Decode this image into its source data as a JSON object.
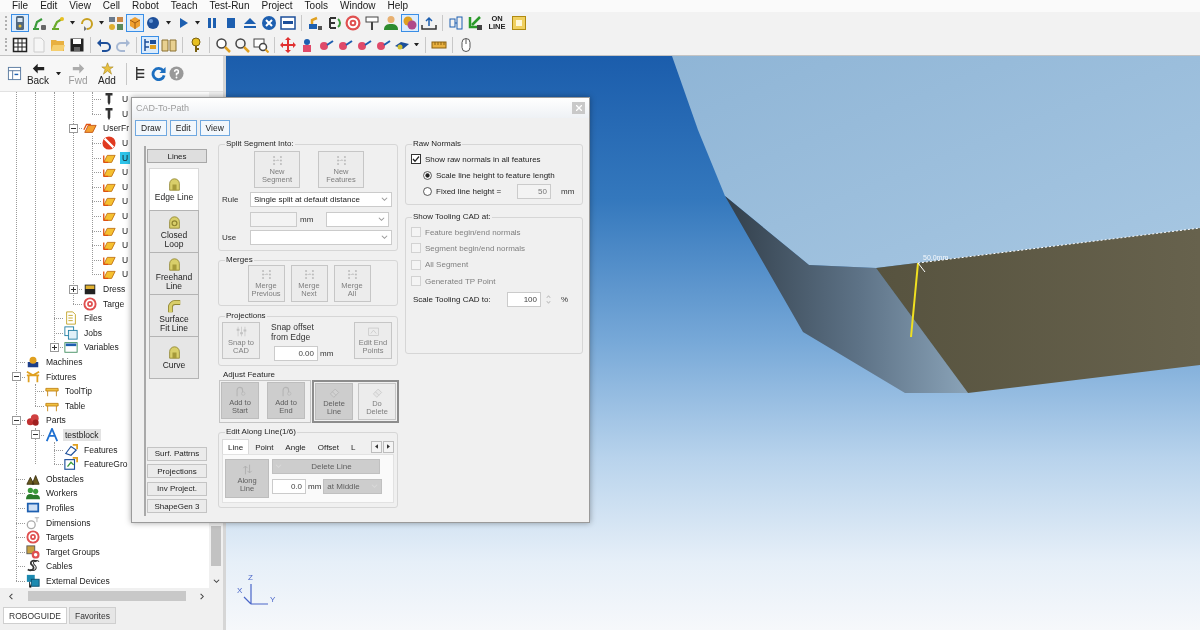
{
  "menu": [
    "File",
    "Edit",
    "View",
    "Cell",
    "Robot",
    "Teach",
    "Test-Run",
    "Project",
    "Tools",
    "Window",
    "Help"
  ],
  "toolbar_1": [
    {
      "kind": "pendant",
      "pressed": true
    },
    {
      "kind": "robot-lock",
      "pressed": false
    },
    {
      "kind": "robot-arm",
      "pressed": false
    },
    {
      "kind": "caret"
    },
    {
      "kind": "loop",
      "pressed": false
    },
    {
      "kind": "caret"
    },
    {
      "kind": "components",
      "pressed": false
    },
    {
      "kind": "cube",
      "pressed": true
    },
    {
      "kind": "sphere",
      "pressed": false
    },
    {
      "kind": "caret"
    },
    {
      "kind": "play",
      "pressed": false
    },
    {
      "kind": "caret"
    },
    {
      "kind": "pause",
      "pressed": false
    },
    {
      "kind": "stop",
      "pressed": false
    },
    {
      "kind": "eject",
      "pressed": false
    },
    {
      "kind": "cancel",
      "pressed": false
    },
    {
      "kind": "display",
      "pressed": false
    },
    {
      "kind": "separator"
    },
    {
      "kind": "robot-home",
      "pressed": false
    },
    {
      "kind": "rotate",
      "pressed": false
    },
    {
      "kind": "target",
      "pressed": false
    },
    {
      "kind": "signpost",
      "pressed": false
    },
    {
      "kind": "person",
      "pressed": false
    },
    {
      "kind": "collision",
      "pressed": true
    },
    {
      "kind": "upload",
      "pressed": false
    },
    {
      "kind": "separator"
    },
    {
      "kind": "connector",
      "pressed": false
    },
    {
      "kind": "arrow-corner",
      "pressed": false
    },
    {
      "kind": "online",
      "label": "ON LINE",
      "pressed": false
    },
    {
      "kind": "frame-tool",
      "pressed": false
    }
  ],
  "toolbar_2": [
    {
      "kind": "grid",
      "pressed": false,
      "disabled": false
    },
    {
      "kind": "new",
      "pressed": false,
      "disabled": true
    },
    {
      "kind": "open",
      "pressed": false,
      "disabled": false
    },
    {
      "kind": "save",
      "pressed": false,
      "disabled": false
    },
    {
      "kind": "separator"
    },
    {
      "kind": "undo",
      "pressed": false,
      "disabled": false
    },
    {
      "kind": "redo",
      "pressed": false,
      "disabled": true
    },
    {
      "kind": "separator"
    },
    {
      "kind": "tree-view",
      "pressed": true,
      "disabled": false
    },
    {
      "kind": "book",
      "pressed": false,
      "disabled": false
    },
    {
      "kind": "separator"
    },
    {
      "kind": "key",
      "pressed": false,
      "disabled": false
    },
    {
      "kind": "separator"
    },
    {
      "kind": "zoom-in",
      "pressed": false,
      "disabled": false
    },
    {
      "kind": "zoom-out",
      "pressed": false,
      "disabled": false
    },
    {
      "kind": "zoom-window",
      "pressed": false,
      "disabled": false
    },
    {
      "kind": "separator"
    },
    {
      "kind": "move",
      "pressed": false,
      "disabled": false
    },
    {
      "kind": "jog",
      "pressed": false,
      "disabled": false
    },
    {
      "kind": "joint",
      "pressed": false,
      "disabled": false
    },
    {
      "kind": "joint",
      "pressed": false,
      "disabled": false
    },
    {
      "kind": "joint",
      "pressed": false,
      "disabled": false
    },
    {
      "kind": "joint",
      "pressed": false,
      "disabled": false
    },
    {
      "kind": "tool",
      "pressed": false,
      "disabled": false
    },
    {
      "kind": "caret"
    },
    {
      "kind": "separator"
    },
    {
      "kind": "ruler",
      "pressed": false,
      "disabled": false
    },
    {
      "kind": "separator"
    },
    {
      "kind": "mouse",
      "pressed": false,
      "disabled": false
    }
  ],
  "browser_toolbar": [
    {
      "kind": "panel",
      "disabled": false
    },
    {
      "kind": "back",
      "label": "Back",
      "disabled": false
    },
    {
      "kind": "caret"
    },
    {
      "kind": "forward",
      "label": "Fwd",
      "disabled": true
    },
    {
      "kind": "add",
      "label": "Add",
      "disabled": false
    },
    {
      "kind": "separator"
    },
    {
      "kind": "hierarchy",
      "disabled": false
    },
    {
      "kind": "refresh",
      "disabled": false
    },
    {
      "kind": "help",
      "disabled": false
    }
  ],
  "tree": {
    "items": [
      {
        "children": [
          {
            "children": [
              {
                "children": [
                  {
                    "children": [
                      {
                        "kind": "tool-pin",
                        "label": "U",
                        "selected": false
                      },
                      {
                        "kind": "tool-pin",
                        "label": "U",
                        "selected": false
                      }
                    ]
                  },
                  {
                    "kind": "frames",
                    "label": "UserFr",
                    "expanded": true,
                    "selected": false,
                    "children": [
                      {
                        "kind": "frame-error",
                        "label": "U",
                        "selected": false
                      },
                      {
                        "kind": "user-frame",
                        "label": "U",
                        "selected": true
                      },
                      {
                        "kind": "user-frame",
                        "label": "U",
                        "selected": false
                      },
                      {
                        "kind": "user-frame",
                        "label": "U",
                        "selected": false
                      },
                      {
                        "kind": "user-frame",
                        "label": "U",
                        "selected": false
                      },
                      {
                        "kind": "user-frame",
                        "label": "U",
                        "selected": false
                      },
                      {
                        "kind": "user-frame",
                        "label": "U",
                        "selected": false
                      },
                      {
                        "kind": "user-frame",
                        "label": "U",
                        "selected": false
                      },
                      {
                        "kind": "user-frame",
                        "label": "U",
                        "selected": false
                      },
                      {
                        "kind": "user-frame",
                        "label": "U",
                        "selected": false
                      }
                    ]
                  },
                  {
                    "kind": "dresser",
                    "label": "Dress",
                    "expanded": false,
                    "selected": false
                  },
                  {
                    "kind": "target",
                    "label": "Targe",
                    "selected": false
                  }
                ]
              },
              {
                "kind": "files",
                "label": "Files",
                "selected": false
              },
              {
                "kind": "jobs",
                "label": "Jobs",
                "selected": false
              },
              {
                "kind": "variables",
                "label": "Variables",
                "expanded": false,
                "selected": false
              }
            ]
          }
        ]
      },
      {
        "kind": "machines",
        "label": "Machines",
        "selected": false
      },
      {
        "kind": "fixtures",
        "label": "Fixtures",
        "expanded": true,
        "selected": false,
        "children": [
          {
            "kind": "fixture",
            "label": "ToolTip",
            "selected": false
          },
          {
            "kind": "fixture",
            "label": "Table",
            "selected": false
          }
        ]
      },
      {
        "kind": "parts",
        "label": "Parts",
        "expanded": true,
        "selected": false,
        "children": [
          {
            "kind": "part",
            "label": "testblock",
            "expanded": true,
            "selected": false,
            "current": true,
            "children": [
              {
                "kind": "features",
                "label": "Features",
                "selected": false
              },
              {
                "kind": "feature-groups",
                "label": "FeatureGro",
                "selected": false
              }
            ]
          }
        ]
      },
      {
        "kind": "obstacles",
        "label": "Obstacles",
        "selected": false
      },
      {
        "kind": "workers",
        "label": "Workers",
        "selected": false
      },
      {
        "kind": "profiles",
        "label": "Profiles",
        "selected": false
      },
      {
        "kind": "dimensions",
        "label": "Dimensions",
        "selected": false
      },
      {
        "kind": "targets",
        "label": "Targets",
        "selected": false
      },
      {
        "kind": "target-groups",
        "label": "Target Groups",
        "selected": false
      },
      {
        "kind": "cables",
        "label": "Cables",
        "selected": false
      },
      {
        "kind": "external-devices",
        "label": "External Devices",
        "selected": false
      }
    ]
  },
  "browser_tabs": [
    {
      "label": "ROBOGUIDE",
      "selected": true
    },
    {
      "label": "Favorites",
      "selected": false
    }
  ],
  "viewport": {
    "measurement": "50.0mm",
    "axes": [
      "Z",
      "X",
      "Y"
    ]
  },
  "dialog": {
    "title": "CAD-To-Path",
    "menu": [
      "Draw",
      "Edit",
      "View"
    ],
    "side_tabs": [
      {
        "label": "Lines",
        "selected": true
      },
      {
        "label": "Surf. Pattrns",
        "selected": false
      },
      {
        "label": "Projections",
        "selected": false
      },
      {
        "label": "Inv Project.",
        "selected": false
      },
      {
        "label": "ShapeGen 3",
        "selected": false
      }
    ],
    "tools": [
      {
        "kind": "arch",
        "label": "Edge Line",
        "selected": true
      },
      {
        "kind": "ring",
        "label": "Closed\nLoop",
        "selected": false
      },
      {
        "kind": "arch",
        "label": "Freehand\nLine",
        "selected": false
      },
      {
        "kind": "pipe",
        "label": "Surface\nFit Line",
        "selected": false
      },
      {
        "kind": "arch",
        "label": "Curve",
        "selected": false
      }
    ],
    "split": {
      "title": "Split Segment Into:",
      "buttons": [
        {
          "label": "New\nSegment",
          "disabled": true
        },
        {
          "label": "New\nFeatures",
          "disabled": true
        }
      ],
      "rule_label": "Rule",
      "rule": {
        "value": "Single split at default distance",
        "disabled": false
      },
      "distance": {
        "disabled": true
      },
      "distance_unit": "mm",
      "distance_mode": {
        "disabled": false
      },
      "use_label": "Use",
      "use": {
        "disabled": false
      }
    },
    "merges": {
      "title": "Merges",
      "buttons": [
        {
          "label": "Merge\nPrevious",
          "disabled": true
        },
        {
          "label": "Merge\nNext",
          "disabled": true
        },
        {
          "label": "Merge\nAll",
          "disabled": true
        }
      ]
    },
    "projections": {
      "title": "Projections",
      "snap": {
        "label": "Snap to\nCAD",
        "disabled": true
      },
      "offset_label": "Snap offset\nfrom Edge",
      "offset": {
        "value": "0.00",
        "disabled": false
      },
      "offset_unit": "mm",
      "end_points": {
        "label": "Edit End\nPoints",
        "disabled": true
      }
    },
    "adjust": {
      "title": "Adjust Feature",
      "button_groups": [
        {
          "buttons": [
            {
              "kind": "toggle",
              "label": "Add to\nStart",
              "disabled": true
            },
            {
              "kind": "toggle",
              "label": "Add to\nEnd",
              "disabled": true
            }
          ]
        },
        {
          "buttons": [
            {
              "kind": "toggle",
              "label": "Delete\nLine",
              "disabled": true
            },
            {
              "kind": "push",
              "label": "Do\nDelete",
              "disabled": true
            }
          ]
        }
      ]
    },
    "edit_along": {
      "title": "Edit Along Line(1/6)",
      "tabs": [
        {
          "label": "Line",
          "selected": true
        },
        {
          "label": "Point",
          "selected": false
        },
        {
          "label": "Angle",
          "selected": false
        },
        {
          "label": "Offset",
          "selected": false
        },
        {
          "label": "L",
          "selected": false
        }
      ],
      "along": {
        "kind": "toggle",
        "label": "Along\nLine",
        "disabled": true
      },
      "action": {
        "value": "Delete Line",
        "disabled": true
      },
      "distance": {
        "value": "0.0",
        "disabled": false
      },
      "distance_unit": "mm",
      "anchor": {
        "value": "at Middle",
        "disabled": true
      }
    },
    "raw_normals": {
      "title": "Raw Normals",
      "show": {
        "label": "Show raw normals in all features",
        "checked": true,
        "disabled": false
      },
      "options": [
        {
          "label": "Scale line height to feature length",
          "selected": true
        },
        {
          "label": "Fixed line height =",
          "selected": false,
          "field": {
            "value": "50",
            "disabled": true
          },
          "unit": "mm"
        }
      ]
    },
    "tooling": {
      "title": "Show Tooling CAD at:",
      "options": [
        {
          "label": "Feature begin/end normals",
          "checked": false,
          "disabled": true
        },
        {
          "label": "Segment begin/end normals",
          "checked": false,
          "disabled": true
        },
        {
          "label": "All Segment",
          "checked": false,
          "disabled": true
        },
        {
          "label": "Generated TP Point",
          "checked": false,
          "disabled": true
        }
      ],
      "scale_label": "Scale Tooling CAD to:",
      "scale": {
        "value": "100",
        "disabled": false
      },
      "scale_unit": "%"
    }
  }
}
